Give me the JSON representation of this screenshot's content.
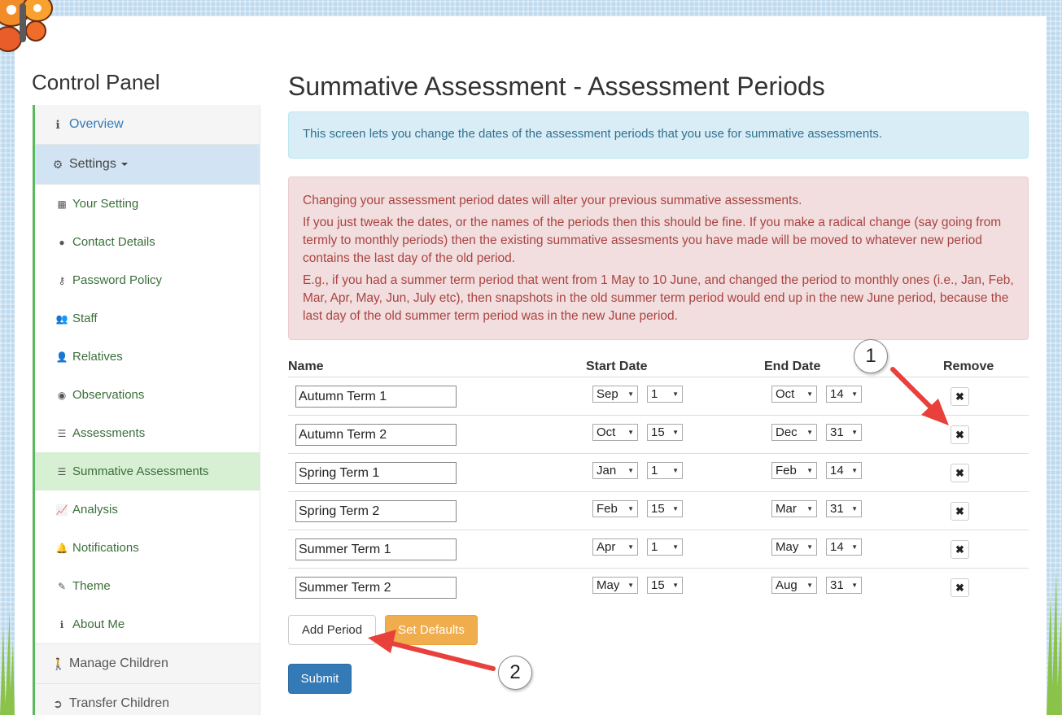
{
  "colors": {
    "sidebar_accent": "#5cb85c",
    "info_bg": "#d9edf7",
    "danger_bg": "#f2dede",
    "warning_button": "#f0ad4e",
    "primary_button": "#337ab7",
    "annotation_arrow": "#e8403a"
  },
  "sidebar": {
    "title": "Control Panel",
    "overview": {
      "label": "Overview",
      "icon": "info-icon"
    },
    "settings": {
      "label": "Settings",
      "icon": "gear-icon"
    },
    "items": [
      {
        "label": "Your Setting",
        "icon": "building-icon"
      },
      {
        "label": "Contact Details",
        "icon": "comment-icon"
      },
      {
        "label": "Password Policy",
        "icon": "key-icon"
      },
      {
        "label": "Staff",
        "icon": "users-icon"
      },
      {
        "label": "Relatives",
        "icon": "user-icon"
      },
      {
        "label": "Observations",
        "icon": "eye-icon"
      },
      {
        "label": "Assessments",
        "icon": "list-icon"
      },
      {
        "label": "Summative Assessments",
        "icon": "list-icon"
      },
      {
        "label": "Analysis",
        "icon": "chart-icon"
      },
      {
        "label": "Notifications",
        "icon": "bell-icon"
      },
      {
        "label": "Theme",
        "icon": "brush-icon"
      },
      {
        "label": "About Me",
        "icon": "info-icon"
      }
    ],
    "manage_children": {
      "label": "Manage Children",
      "icon": "child-icon"
    },
    "transfer_children": {
      "label": "Transfer Children",
      "icon": "transfer-icon"
    }
  },
  "main": {
    "title": "Summative Assessment - Assessment Periods",
    "info": "This screen lets you change the dates of the assessment periods that you use for summative assessments.",
    "warning": [
      "Changing your assessment period dates will alter your previous summative assessments.",
      "If you just tweak the dates, or the names of the periods then this should be fine. If you make a radical change (say going from termly to monthly periods) then the existing summative assesments you have made will be moved to whatever new period contains the last day of the old period.",
      "E.g., if you had a summer term period that went from 1 May to 10 June, and changed the period to monthly ones (i.e., Jan, Feb, Mar, Apr, May, Jun, July etc), then snapshots in the old summer term period would end up in the new June period, because the last day of the old summer term period was in the new June period."
    ],
    "table": {
      "headers": {
        "name": "Name",
        "start": "Start Date",
        "end": "End Date",
        "remove": "Remove"
      },
      "rows": [
        {
          "name": "Autumn Term 1",
          "start_month": "Sep",
          "start_day": "1",
          "end_month": "Oct",
          "end_day": "14"
        },
        {
          "name": "Autumn Term 2",
          "start_month": "Oct",
          "start_day": "15",
          "end_month": "Dec",
          "end_day": "31"
        },
        {
          "name": "Spring Term 1",
          "start_month": "Jan",
          "start_day": "1",
          "end_month": "Feb",
          "end_day": "14"
        },
        {
          "name": "Spring Term 2",
          "start_month": "Feb",
          "start_day": "15",
          "end_month": "Mar",
          "end_day": "31"
        },
        {
          "name": "Summer Term 1",
          "start_month": "Apr",
          "start_day": "1",
          "end_month": "May",
          "end_day": "14"
        },
        {
          "name": "Summer Term 2",
          "start_month": "May",
          "start_day": "15",
          "end_month": "Aug",
          "end_day": "31"
        }
      ]
    },
    "buttons": {
      "add": "Add Period",
      "defaults": "Set Defaults",
      "submit": "Submit"
    }
  },
  "callouts": {
    "one": "1",
    "two": "2"
  }
}
